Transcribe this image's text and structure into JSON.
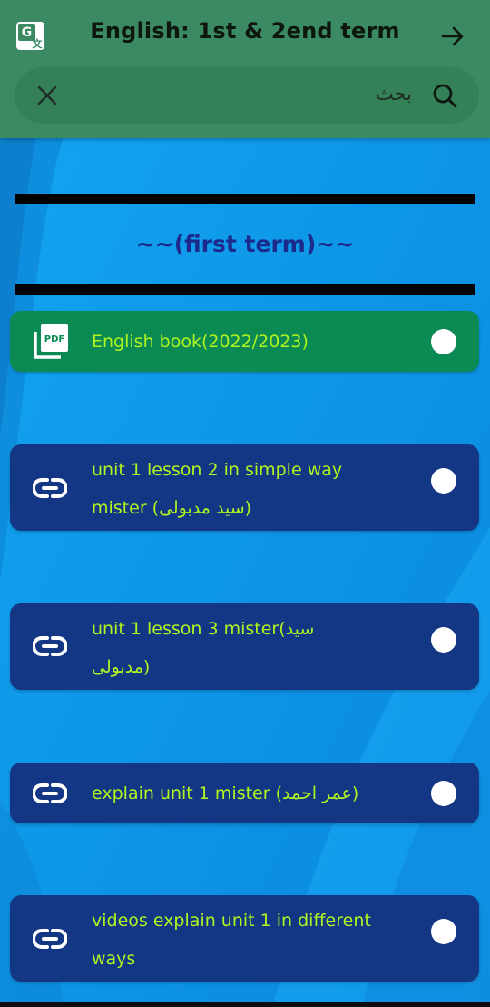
{
  "header": {
    "title": "English: 1st & 2end term",
    "translate_icon": "translate-icon",
    "back_icon": "arrow-right-icon"
  },
  "search": {
    "placeholder": "بحث",
    "clear_icon": "close-icon",
    "search_icon": "search-icon"
  },
  "section": {
    "title": "~~(first term)~~"
  },
  "items": [
    {
      "icon": "pdf-icon",
      "line1": "English book(2022/2023)"
    },
    {
      "icon": "link-icon",
      "line1": "unit 1 lesson 2 in simple way",
      "line2": "mister (سيد مدبولى)"
    },
    {
      "icon": "link-icon",
      "line1": "unit 1 lesson 3 mister(سيد",
      "line2": "مدبولى)"
    },
    {
      "icon": "link-icon",
      "line1": "explain unit 1 mister (عمر احمد)"
    },
    {
      "icon": "link-icon",
      "line1": "videos explain unit 1 in different",
      "line2": "ways"
    }
  ],
  "colors": {
    "appbar": "#3b8a63",
    "background": "#0a8fe0",
    "pdf_card": "#0b8a53",
    "link_card": "#143785",
    "item_text": "#b0f51f",
    "section_title": "#1b2a8c"
  }
}
